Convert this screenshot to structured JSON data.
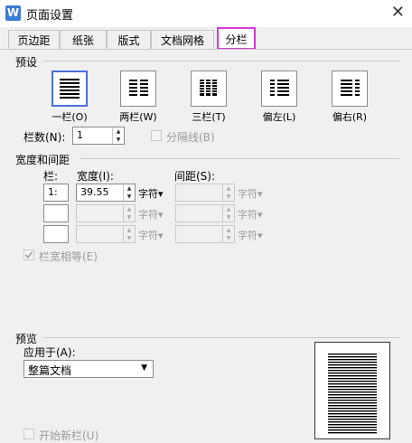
{
  "window": {
    "title": "页面设置",
    "app_icon": "W",
    "close_icon": "✕"
  },
  "tabs": [
    {
      "label": "页边距"
    },
    {
      "label": "纸张"
    },
    {
      "label": "版式"
    },
    {
      "label": "文档网格"
    },
    {
      "label": "分栏",
      "active": true
    }
  ],
  "presets": {
    "section_label": "预设",
    "items": [
      {
        "label": "一栏(O)",
        "icon": "one-column-icon",
        "selected": true
      },
      {
        "label": "两栏(W)",
        "icon": "two-column-icon"
      },
      {
        "label": "三栏(T)",
        "icon": "three-column-icon"
      },
      {
        "label": "偏左(L)",
        "icon": "left-column-icon"
      },
      {
        "label": "偏右(R)",
        "icon": "right-column-icon"
      }
    ]
  },
  "columns_count": {
    "label": "栏数(N):",
    "value": "1"
  },
  "separator": {
    "label": "分隔线(B)",
    "checked": false,
    "disabled": true
  },
  "width_spacing": {
    "section_label": "宽度和间距",
    "col_header": "栏:",
    "width_header": "宽度(I):",
    "spacing_header": "间距(S):",
    "unit": "字符",
    "rows": [
      {
        "index": "1:",
        "width": "39.55",
        "spacing": "",
        "enabled": true
      },
      {
        "index": "",
        "width": "",
        "spacing": "",
        "enabled": false
      },
      {
        "index": "",
        "width": "",
        "spacing": "",
        "enabled": false
      }
    ]
  },
  "equal_width": {
    "label": "栏宽相等(E)",
    "checked": true,
    "disabled": true
  },
  "preview": {
    "section_label": "预览",
    "apply_to_label": "应用于(A):",
    "apply_to_value": "整篇文档"
  },
  "new_column": {
    "label": "开始新栏(U)",
    "checked": false,
    "disabled": true
  },
  "colors": {
    "tab_highlight": "#d43bd4",
    "selection": "#4a6fd8"
  }
}
